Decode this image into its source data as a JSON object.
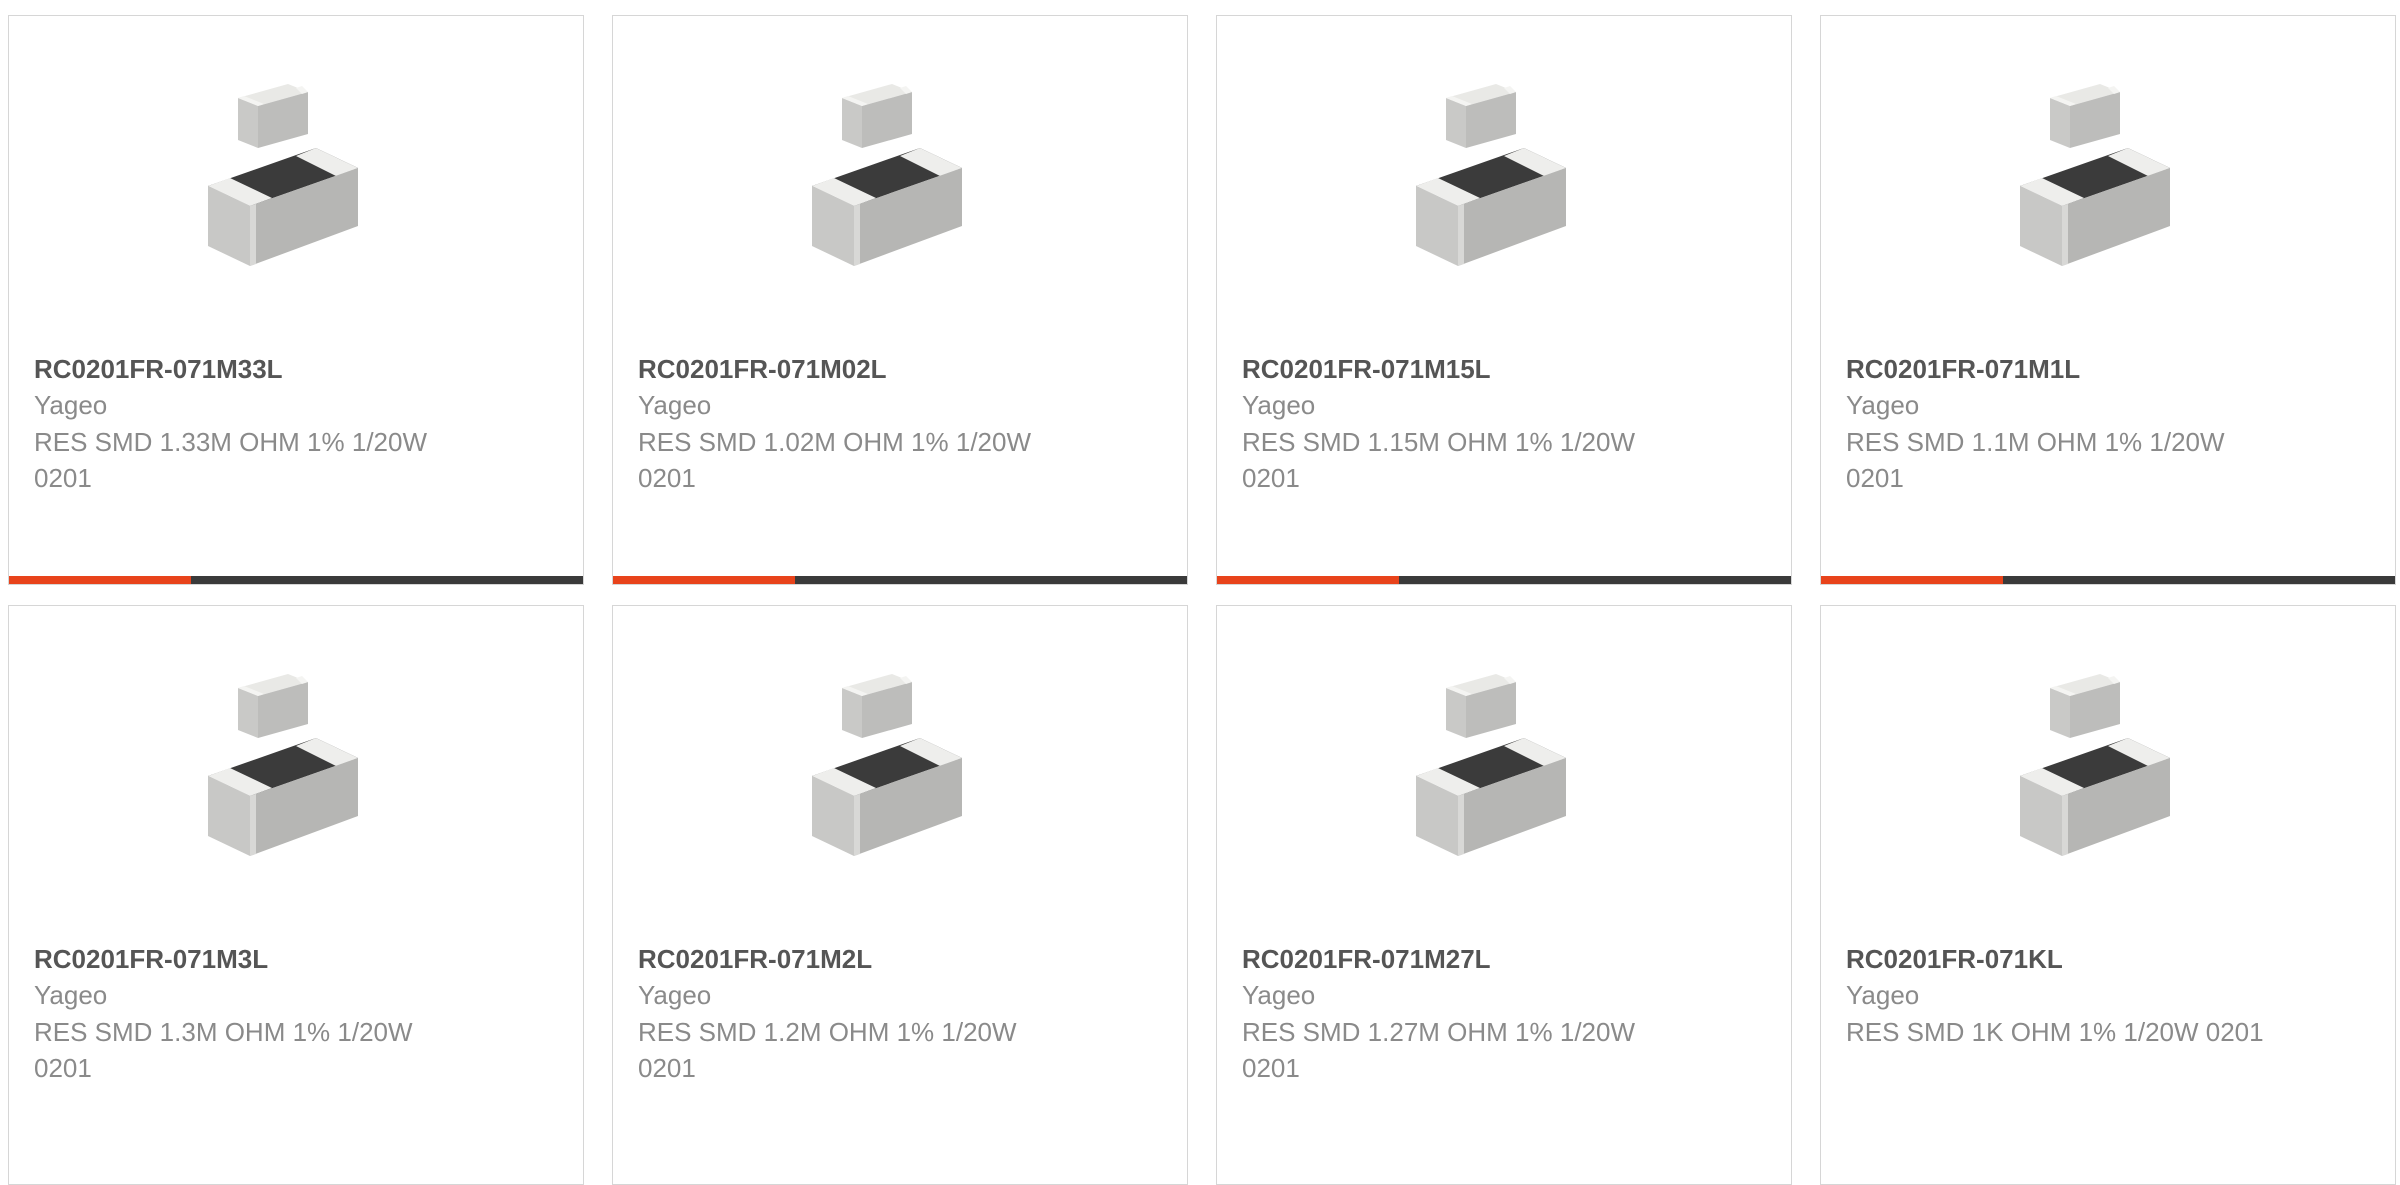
{
  "colors": {
    "accent": "#e8431b",
    "bar": "#3a3a3a",
    "title": "#555555",
    "text": "#8a8a8a"
  },
  "products": [
    {
      "part_number": "RC0201FR-071M33L",
      "manufacturer": "Yageo",
      "description": "RES SMD 1.33M OHM 1% 1/20W 0201",
      "image_icon": "smd-resistor-image"
    },
    {
      "part_number": "RC0201FR-071M02L",
      "manufacturer": "Yageo",
      "description": "RES SMD 1.02M OHM 1% 1/20W 0201",
      "image_icon": "smd-resistor-image"
    },
    {
      "part_number": "RC0201FR-071M15L",
      "manufacturer": "Yageo",
      "description": "RES SMD 1.15M OHM 1% 1/20W 0201",
      "image_icon": "smd-resistor-image"
    },
    {
      "part_number": "RC0201FR-071M1L",
      "manufacturer": "Yageo",
      "description": "RES SMD 1.1M OHM 1% 1/20W 0201",
      "image_icon": "smd-resistor-image"
    },
    {
      "part_number": "RC0201FR-071M3L",
      "manufacturer": "Yageo",
      "description": "RES SMD 1.3M OHM 1% 1/20W 0201",
      "image_icon": "smd-resistor-image"
    },
    {
      "part_number": "RC0201FR-071M2L",
      "manufacturer": "Yageo",
      "description": "RES SMD 1.2M OHM 1% 1/20W 0201",
      "image_icon": "smd-resistor-image"
    },
    {
      "part_number": "RC0201FR-071M27L",
      "manufacturer": "Yageo",
      "description": "RES SMD 1.27M OHM 1% 1/20W 0201",
      "image_icon": "smd-resistor-image"
    },
    {
      "part_number": "RC0201FR-071KL",
      "manufacturer": "Yageo",
      "description": "RES SMD 1K OHM 1% 1/20W 0201",
      "image_icon": "smd-resistor-image"
    }
  ]
}
